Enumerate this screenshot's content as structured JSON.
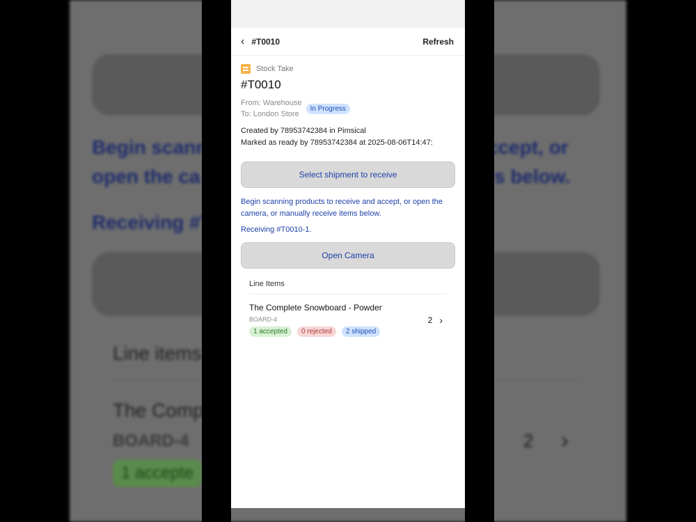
{
  "nav": {
    "back_icon": "‹",
    "title": "#T0010",
    "refresh_label": "Refresh"
  },
  "order": {
    "type_label": "Stock Take",
    "id": "#T0010",
    "from": "From: Warehouse",
    "to": "To: London Store",
    "status": "In Progress",
    "created_by": "Created by 78953742384 in Pimsical",
    "marked_ready": "Marked as ready by 78953742384 at 2025-08-06T14:47:"
  },
  "actions": {
    "select_shipment": "Select shipment to receive",
    "instruction": "Begin scanning products to receive and accept, or open the camera, or manually receive items below.",
    "receiving": "Receiving #T0010-1.",
    "open_camera": "Open Camera"
  },
  "line_items": {
    "header": "Line Items",
    "items": [
      {
        "name": "The Complete Snowboard - Powder",
        "sku": "BOARD-4",
        "accepted": "1 accepted",
        "rejected": "0 rejected",
        "shipped": "2 shipped",
        "quantity": "2",
        "chevron": "›"
      }
    ]
  },
  "background": {
    "instruction_line1_left": "Begin scann",
    "instruction_line1_right": "ccept, or",
    "instruction_line2_left": "open the ca",
    "instruction_line2_right": "s below.",
    "receiving": "Receiving #T",
    "line_items_header": "Line items",
    "product_name": "The Comp",
    "sku": "BOARD-4",
    "accepted_badge": "1 accepte",
    "quantity": "2",
    "chevron": "›"
  },
  "colors": {
    "link_blue": "#1d3fa8",
    "status_bg": "#cfe2ff",
    "accepted_bg": "#d8f1d4",
    "rejected_bg": "#f8d7d7"
  }
}
